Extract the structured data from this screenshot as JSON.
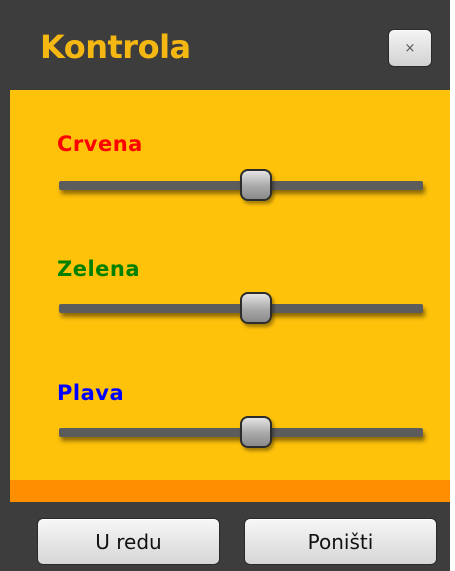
{
  "window": {
    "title": "Kontrola",
    "close_icon": "close-icon",
    "close_glyph": "×"
  },
  "sliders": [
    {
      "label": "Crvena",
      "color": "#ff0000",
      "value": 0.5
    },
    {
      "label": "Zelena",
      "color": "#008000",
      "value": 0.5
    },
    {
      "label": "Plava",
      "color": "#0000ff",
      "value": 0.5
    }
  ],
  "buttons": {
    "ok_label": "U redu",
    "cancel_label": "Poništi"
  },
  "colors": {
    "title": "#f5b812",
    "panel": "#fec20b",
    "stripe": "#fe8f00",
    "frame": "#3d3d3d"
  }
}
